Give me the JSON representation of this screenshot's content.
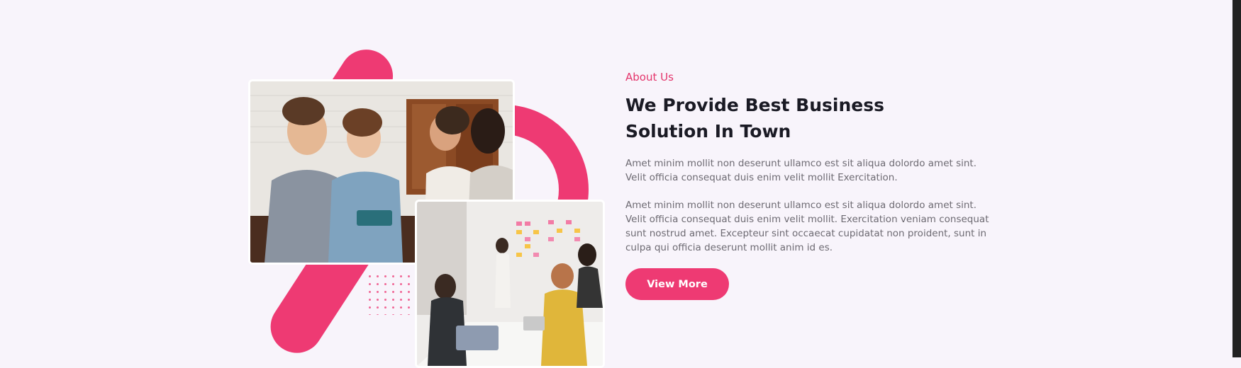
{
  "about": {
    "eyebrow": "About Us",
    "heading": "We Provide Best Business Solution In Town",
    "paragraph_1": "Amet minim mollit non deserunt ullamco est sit aliqua dolordo amet sint. Velit officia consequat duis enim velit mollit Exercitation.",
    "paragraph_2": "Amet minim mollit non deserunt ullamco est sit aliqua dolordo amet sint. Velit officia consequat duis enim velit mollit. Exercitation veniam consequat sunt nostrud amet. Excepteur sint occaecat cupidatat non proident, sunt in culpa qui officia deserunt mollit anim id es.",
    "button_label": "View More"
  },
  "colors": {
    "accent": "#ee3a73",
    "background": "#f8f4fb",
    "heading": "#1a1a24",
    "body_text": "#6d6a72"
  }
}
